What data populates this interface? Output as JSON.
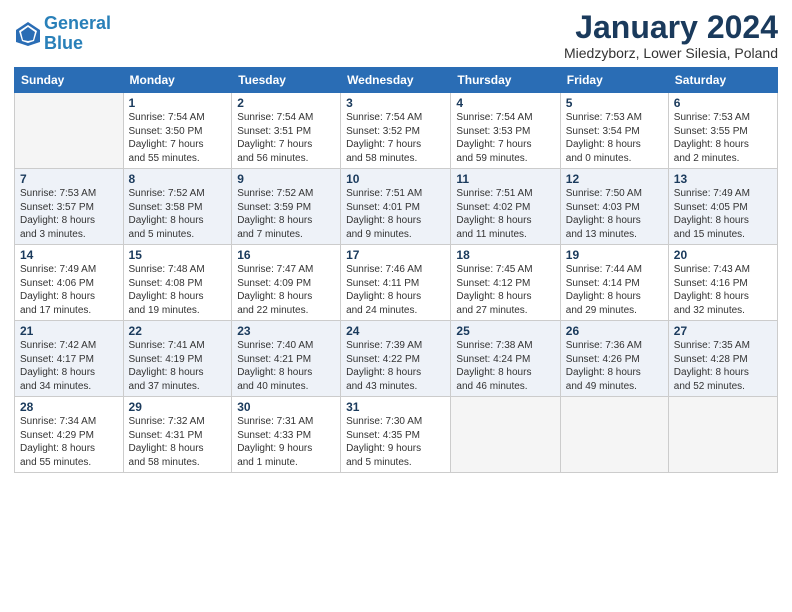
{
  "header": {
    "logo_line1": "General",
    "logo_line2": "Blue",
    "title": "January 2024",
    "subtitle": "Miedzyborz, Lower Silesia, Poland"
  },
  "calendar": {
    "days_of_week": [
      "Sunday",
      "Monday",
      "Tuesday",
      "Wednesday",
      "Thursday",
      "Friday",
      "Saturday"
    ],
    "weeks": [
      [
        {
          "day": "",
          "info": ""
        },
        {
          "day": "1",
          "info": "Sunrise: 7:54 AM\nSunset: 3:50 PM\nDaylight: 7 hours\nand 55 minutes."
        },
        {
          "day": "2",
          "info": "Sunrise: 7:54 AM\nSunset: 3:51 PM\nDaylight: 7 hours\nand 56 minutes."
        },
        {
          "day": "3",
          "info": "Sunrise: 7:54 AM\nSunset: 3:52 PM\nDaylight: 7 hours\nand 58 minutes."
        },
        {
          "day": "4",
          "info": "Sunrise: 7:54 AM\nSunset: 3:53 PM\nDaylight: 7 hours\nand 59 minutes."
        },
        {
          "day": "5",
          "info": "Sunrise: 7:53 AM\nSunset: 3:54 PM\nDaylight: 8 hours\nand 0 minutes."
        },
        {
          "day": "6",
          "info": "Sunrise: 7:53 AM\nSunset: 3:55 PM\nDaylight: 8 hours\nand 2 minutes."
        }
      ],
      [
        {
          "day": "7",
          "info": "Sunrise: 7:53 AM\nSunset: 3:57 PM\nDaylight: 8 hours\nand 3 minutes."
        },
        {
          "day": "8",
          "info": "Sunrise: 7:52 AM\nSunset: 3:58 PM\nDaylight: 8 hours\nand 5 minutes."
        },
        {
          "day": "9",
          "info": "Sunrise: 7:52 AM\nSunset: 3:59 PM\nDaylight: 8 hours\nand 7 minutes."
        },
        {
          "day": "10",
          "info": "Sunrise: 7:51 AM\nSunset: 4:01 PM\nDaylight: 8 hours\nand 9 minutes."
        },
        {
          "day": "11",
          "info": "Sunrise: 7:51 AM\nSunset: 4:02 PM\nDaylight: 8 hours\nand 11 minutes."
        },
        {
          "day": "12",
          "info": "Sunrise: 7:50 AM\nSunset: 4:03 PM\nDaylight: 8 hours\nand 13 minutes."
        },
        {
          "day": "13",
          "info": "Sunrise: 7:49 AM\nSunset: 4:05 PM\nDaylight: 8 hours\nand 15 minutes."
        }
      ],
      [
        {
          "day": "14",
          "info": "Sunrise: 7:49 AM\nSunset: 4:06 PM\nDaylight: 8 hours\nand 17 minutes."
        },
        {
          "day": "15",
          "info": "Sunrise: 7:48 AM\nSunset: 4:08 PM\nDaylight: 8 hours\nand 19 minutes."
        },
        {
          "day": "16",
          "info": "Sunrise: 7:47 AM\nSunset: 4:09 PM\nDaylight: 8 hours\nand 22 minutes."
        },
        {
          "day": "17",
          "info": "Sunrise: 7:46 AM\nSunset: 4:11 PM\nDaylight: 8 hours\nand 24 minutes."
        },
        {
          "day": "18",
          "info": "Sunrise: 7:45 AM\nSunset: 4:12 PM\nDaylight: 8 hours\nand 27 minutes."
        },
        {
          "day": "19",
          "info": "Sunrise: 7:44 AM\nSunset: 4:14 PM\nDaylight: 8 hours\nand 29 minutes."
        },
        {
          "day": "20",
          "info": "Sunrise: 7:43 AM\nSunset: 4:16 PM\nDaylight: 8 hours\nand 32 minutes."
        }
      ],
      [
        {
          "day": "21",
          "info": "Sunrise: 7:42 AM\nSunset: 4:17 PM\nDaylight: 8 hours\nand 34 minutes."
        },
        {
          "day": "22",
          "info": "Sunrise: 7:41 AM\nSunset: 4:19 PM\nDaylight: 8 hours\nand 37 minutes."
        },
        {
          "day": "23",
          "info": "Sunrise: 7:40 AM\nSunset: 4:21 PM\nDaylight: 8 hours\nand 40 minutes."
        },
        {
          "day": "24",
          "info": "Sunrise: 7:39 AM\nSunset: 4:22 PM\nDaylight: 8 hours\nand 43 minutes."
        },
        {
          "day": "25",
          "info": "Sunrise: 7:38 AM\nSunset: 4:24 PM\nDaylight: 8 hours\nand 46 minutes."
        },
        {
          "day": "26",
          "info": "Sunrise: 7:36 AM\nSunset: 4:26 PM\nDaylight: 8 hours\nand 49 minutes."
        },
        {
          "day": "27",
          "info": "Sunrise: 7:35 AM\nSunset: 4:28 PM\nDaylight: 8 hours\nand 52 minutes."
        }
      ],
      [
        {
          "day": "28",
          "info": "Sunrise: 7:34 AM\nSunset: 4:29 PM\nDaylight: 8 hours\nand 55 minutes."
        },
        {
          "day": "29",
          "info": "Sunrise: 7:32 AM\nSunset: 4:31 PM\nDaylight: 8 hours\nand 58 minutes."
        },
        {
          "day": "30",
          "info": "Sunrise: 7:31 AM\nSunset: 4:33 PM\nDaylight: 9 hours\nand 1 minute."
        },
        {
          "day": "31",
          "info": "Sunrise: 7:30 AM\nSunset: 4:35 PM\nDaylight: 9 hours\nand 5 minutes."
        },
        {
          "day": "",
          "info": ""
        },
        {
          "day": "",
          "info": ""
        },
        {
          "day": "",
          "info": ""
        }
      ]
    ]
  }
}
